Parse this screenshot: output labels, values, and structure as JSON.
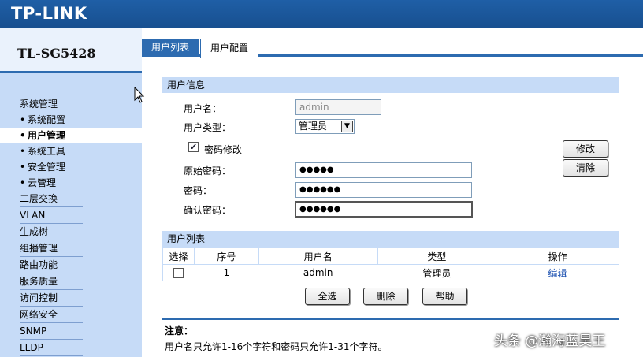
{
  "header": {
    "logo": "TP-LINK"
  },
  "sidebar": {
    "model": "TL-SG5428",
    "system_group": "系统管理",
    "sub_items": [
      {
        "label": "系统配置"
      },
      {
        "label": "用户管理"
      },
      {
        "label": "系统工具"
      },
      {
        "label": "安全管理"
      },
      {
        "label": "云管理"
      }
    ],
    "top_items": [
      {
        "label": "二层交换"
      },
      {
        "label": "VLAN"
      },
      {
        "label": "生成树"
      },
      {
        "label": "组播管理"
      },
      {
        "label": "路由功能"
      },
      {
        "label": "服务质量"
      },
      {
        "label": "访问控制"
      },
      {
        "label": "网络安全"
      },
      {
        "label": "SNMP"
      },
      {
        "label": "LLDP"
      }
    ]
  },
  "tabs": [
    {
      "label": "用户列表"
    },
    {
      "label": "用户配置"
    }
  ],
  "user_info": {
    "section_title": "用户信息",
    "username_label": "用户名：",
    "username_value": "admin",
    "usertype_label": "用户类型：",
    "usertype_value": "管理员",
    "change_pwd_label": "密码修改",
    "old_pwd_label": "原始密码：",
    "old_pwd_value": "●●●●●",
    "pwd_label": "密码：",
    "pwd_value": "●●●●●●",
    "confirm_label": "确认密码：",
    "confirm_value": "●●●●●●",
    "modify_button": "修改",
    "clear_button": "清除"
  },
  "user_list": {
    "section_title": "用户列表",
    "columns": [
      "选择",
      "序号",
      "用户名",
      "类型",
      "操作"
    ],
    "rows": [
      {
        "index": "1",
        "username": "admin",
        "type": "管理员",
        "action": "编辑"
      }
    ],
    "select_all_button": "全选",
    "delete_button": "删除",
    "help_button": "帮助"
  },
  "note": {
    "title": "注意：",
    "text": "用户名只允许1-16个字符和密码只允许1-31个字符。"
  },
  "watermark": "头条 @瀚海蓝昊王",
  "colors": {
    "header": "#1f5fa6",
    "sidebar": "#c6dbf7",
    "accent": "#2d6bb0"
  }
}
